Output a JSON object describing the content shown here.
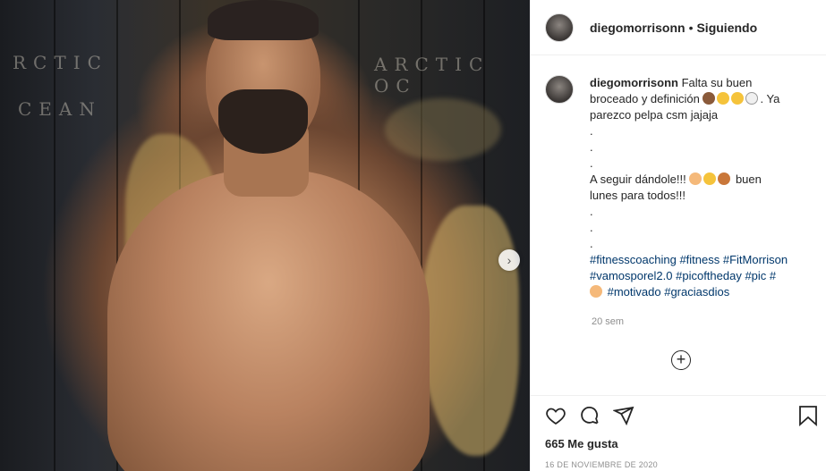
{
  "post": {
    "username": "diegomorrisonn",
    "separator": "•",
    "follow_status": "Siguiendo"
  },
  "caption": {
    "author": "diegomorrisonn",
    "line1": "Falta su buen",
    "line2": "broceado y definición",
    "line2_end": ". Ya",
    "line3": "parezco pelpa csm jajaja",
    "dot": ".",
    "line7": "A seguir dándole!!!",
    "line7_end": " buen",
    "line8": "lunes para todos!!!",
    "hashtags1": "#fitnesscoaching #fitness #FitMorrison",
    "hashtags2": "#vamosporel2.0 #picoftheday #pic #",
    "hashtags3": "#motivado #graciasdios",
    "time_ago": "20 sem"
  },
  "emojis": {
    "line2": [
      "monkey",
      "grin-sweat",
      "joy",
      "ghost"
    ],
    "line7": [
      "flexed-biceps",
      "sunglasses",
      "weightlifter"
    ],
    "hashtag": [
      "flexed-biceps"
    ]
  },
  "stats": {
    "likes": "665 Me gusta",
    "date": "16 DE NOVIEMBRE DE 2020"
  },
  "photo": {
    "lettering": [
      "ARCTIC OC",
      "RCTIC",
      "CEAN"
    ]
  },
  "colors": {
    "hashtag": "#00376b",
    "muted": "#8e8e8e",
    "text": "#262626"
  }
}
